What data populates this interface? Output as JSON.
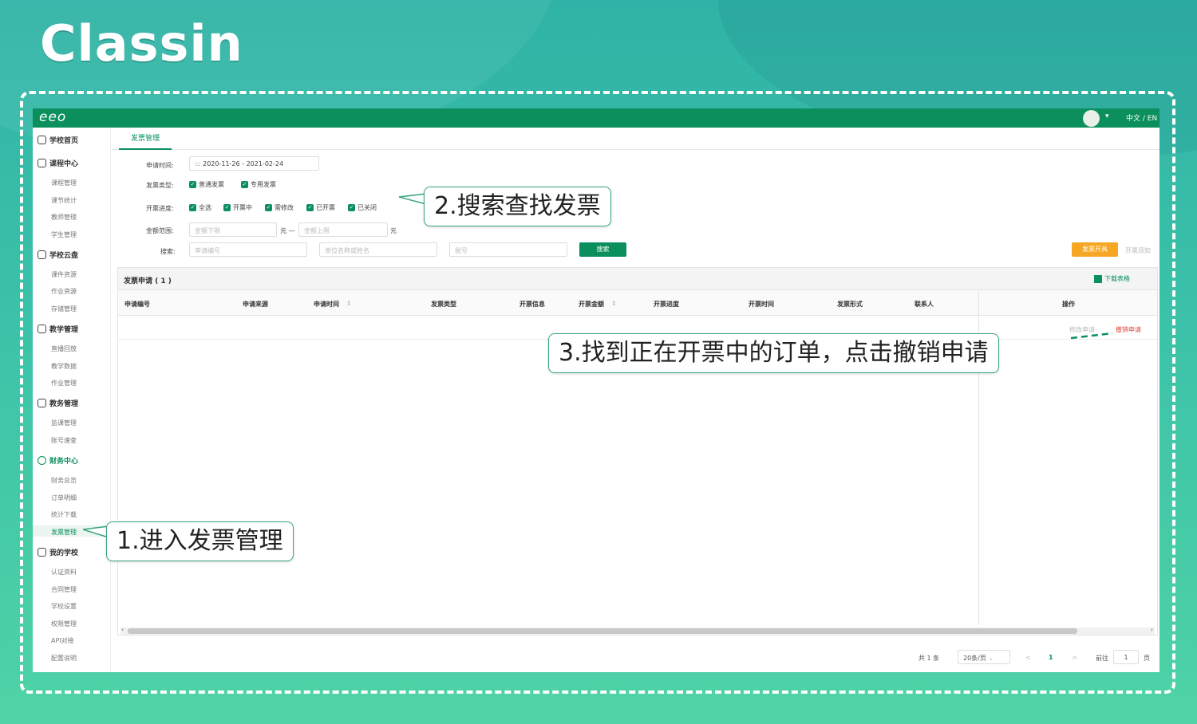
{
  "brand": "Classin",
  "topbar": {
    "logo": "eeo",
    "lang": "中文 / EN"
  },
  "sidebar": {
    "groups": [
      {
        "label": "学校首页",
        "icon": "home-icon"
      },
      {
        "label": "课程中心",
        "icon": "calendar-icon",
        "items": [
          "课程管理",
          "课节统计",
          "教师管理",
          "学生管理"
        ]
      },
      {
        "label": "学校云盘",
        "icon": "cloud-icon",
        "items": [
          "课件资源",
          "作业资源",
          "存储管理"
        ]
      },
      {
        "label": "教学管理",
        "icon": "board-icon",
        "items": [
          "直播回放",
          "教学数据",
          "作业管理"
        ]
      },
      {
        "label": "教务管理",
        "icon": "grid-icon",
        "items": [
          "监课管理",
          "账号速查"
        ]
      },
      {
        "label": "财务中心",
        "icon": "money-icon",
        "items": [
          "财务总览",
          "订单明细",
          "统计下载",
          "发票管理"
        ]
      },
      {
        "label": "我的学校",
        "icon": "settings-icon",
        "items": [
          "认证资料",
          "合同管理",
          "学校设置",
          "权限管理",
          "API对接",
          "配置说明"
        ]
      }
    ]
  },
  "tab": "发票管理",
  "filters": {
    "date_label": "申请时间:",
    "date_value": "2020-11-26  -  2021-02-24",
    "type_label": "发票类型:",
    "types": [
      "普通发票",
      "专用发票"
    ],
    "status_label": "开票进度:",
    "statuses": [
      "全选",
      "开票中",
      "需修改",
      "已开票",
      "已关闭"
    ],
    "amount_label": "金额范围:",
    "amount_min_placeholder": "金额下限",
    "amount_sep": "元 —",
    "amount_max_placeholder": "金额上限",
    "amount_unit": "元",
    "search_label": "搜索:",
    "search_apply_placeholder": "申请编号",
    "search_company_placeholder": "单位名称或姓名",
    "search_tax_placeholder": "税号",
    "search_button": "搜索",
    "issue_button": "发票开具",
    "notice_link": "开票须知"
  },
  "panel": {
    "title": "发票申请 ( 1 )",
    "download": "下载表格",
    "columns": [
      "申请编号",
      "申请来源",
      "申请时间",
      "发票类型",
      "开票信息",
      "开票金额",
      "开票进度",
      "开票时间",
      "发票形式",
      "联系人",
      "操作"
    ],
    "row_actions": [
      "修改申请",
      "撤销申请"
    ]
  },
  "pager": {
    "total": "共 1 条",
    "page_size": "20条/页",
    "prev": "<",
    "page": "1",
    "next": ">",
    "goto_label": "前往",
    "goto_value": "1",
    "goto_unit": "页"
  },
  "callouts": {
    "step1": "1.进入发票管理",
    "step2": "2.搜索查找发票",
    "step3": "3.找到正在开票中的订单，点击撤销申请"
  }
}
